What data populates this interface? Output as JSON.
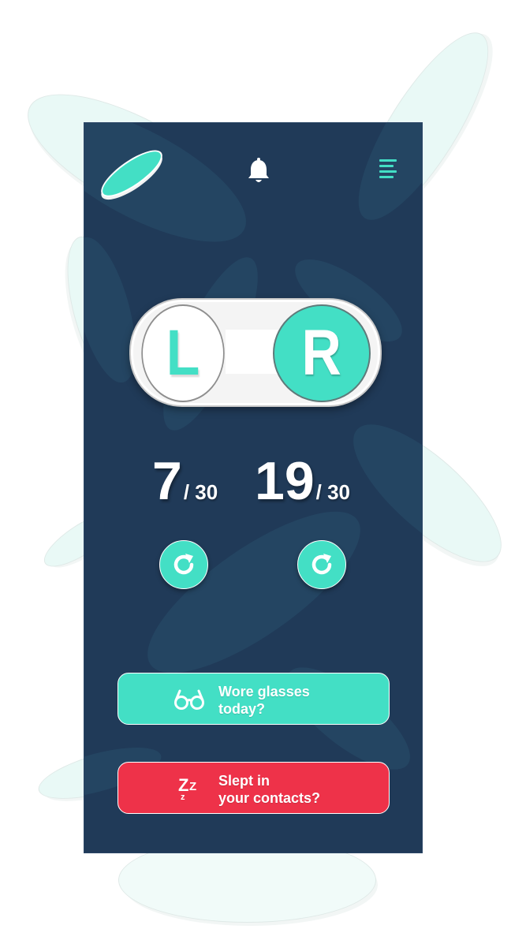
{
  "colors": {
    "accent": "#43dfc5",
    "background": "#203a58",
    "danger": "#ee3249",
    "text": "#ffffff"
  },
  "header": {
    "logo_icon": "contact-lens-logo-icon",
    "bell_icon": "bell-icon",
    "menu_icon": "menu-icon"
  },
  "lens_case": {
    "left_label": "L",
    "right_label": "R",
    "selected": "R"
  },
  "counters": {
    "left": {
      "days": "7",
      "total": "/ 30"
    },
    "right": {
      "days": "19",
      "total": "/ 30"
    }
  },
  "reset_icon": "refresh-icon",
  "actions": {
    "glasses": {
      "icon": "glasses-icon",
      "line1": "Wore glasses",
      "line2": "today?"
    },
    "sleep": {
      "icon": "zzz-sleep-icon",
      "line1": "Slept in",
      "line2": "your contacts?"
    }
  }
}
